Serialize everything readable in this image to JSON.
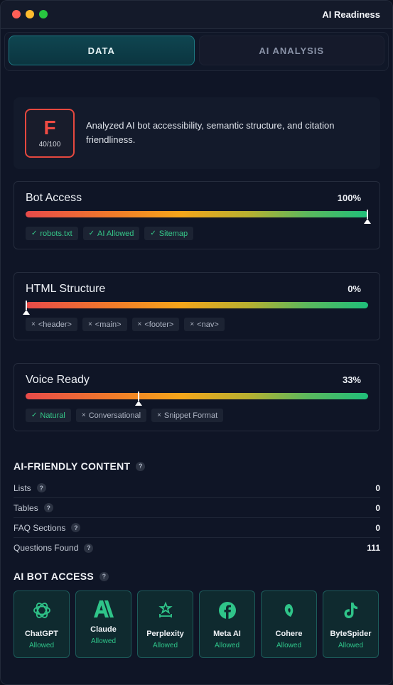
{
  "window": {
    "title": "AI Readiness"
  },
  "tabs": [
    {
      "label": "DATA",
      "active": true
    },
    {
      "label": "AI ANALYSIS",
      "active": false
    }
  ],
  "summary": {
    "grade": "F",
    "score": "40/100",
    "description": "Analyzed AI bot accessibility, semantic structure, and citation friendliness."
  },
  "metrics": [
    {
      "title": "Bot Access",
      "value_label": "100%",
      "level": 1.0,
      "chips": [
        {
          "label": "robots.txt",
          "status": "ok",
          "mark": "✓"
        },
        {
          "label": "AI Allowed",
          "status": "ok",
          "mark": "✓"
        },
        {
          "label": "Sitemap",
          "status": "ok",
          "mark": "✓"
        }
      ]
    },
    {
      "title": "HTML Structure",
      "value_label": "0%",
      "level": 0.0,
      "chips": [
        {
          "label": "<header>",
          "status": "bad",
          "mark": "×"
        },
        {
          "label": "<main>",
          "status": "bad",
          "mark": "×"
        },
        {
          "label": "<footer>",
          "status": "bad",
          "mark": "×"
        },
        {
          "label": "<nav>",
          "status": "bad",
          "mark": "×"
        }
      ]
    },
    {
      "title": "Voice Ready",
      "value_label": "33%",
      "level": 0.33,
      "chips": [
        {
          "label": "Natural",
          "status": "ok",
          "mark": "✓"
        },
        {
          "label": "Conversational",
          "status": "bad",
          "mark": "×"
        },
        {
          "label": "Snippet Format",
          "status": "bad",
          "mark": "×"
        }
      ]
    }
  ],
  "ai_friendly": {
    "title": "AI-FRIENDLY CONTENT",
    "help": "?",
    "rows": [
      {
        "label": "Lists",
        "value": "0"
      },
      {
        "label": "Tables",
        "value": "0"
      },
      {
        "label": "FAQ Sections",
        "value": "0"
      },
      {
        "label": "Questions Found",
        "value": "111"
      }
    ]
  },
  "bot_access": {
    "title": "AI BOT ACCESS",
    "help": "?",
    "bots": [
      {
        "name": "ChatGPT",
        "status": "Allowed",
        "icon": "openai-icon"
      },
      {
        "name": "Claude",
        "status": "Allowed",
        "icon": "anthropic-icon"
      },
      {
        "name": "Perplexity",
        "status": "Allowed",
        "icon": "perplexity-icon"
      },
      {
        "name": "Meta AI",
        "status": "Allowed",
        "icon": "facebook-icon"
      },
      {
        "name": "Cohere",
        "status": "Allowed",
        "icon": "cohere-icon"
      },
      {
        "name": "ByteSpider",
        "status": "Allowed",
        "icon": "tiktok-icon"
      }
    ],
    "icon_color": "#2fc489"
  },
  "colors": {
    "accent_teal": "#1d7a83",
    "grade_red": "#ef4b43",
    "ok_green": "#35c889",
    "background": "#0f1526"
  }
}
